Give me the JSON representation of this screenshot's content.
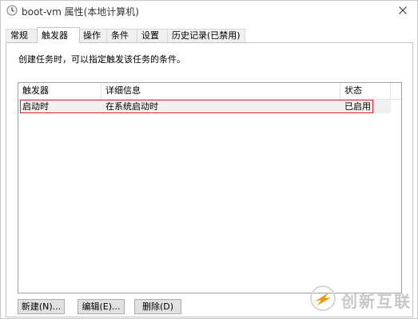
{
  "window": {
    "title": "boot-vm 属性(本地计算机)"
  },
  "tabs": [
    {
      "label": "常规",
      "active": false
    },
    {
      "label": "触发器",
      "active": true
    },
    {
      "label": "操作",
      "active": false
    },
    {
      "label": "条件",
      "active": false
    },
    {
      "label": "设置",
      "active": false
    },
    {
      "label": "历史记录(已禁用)",
      "active": false
    }
  ],
  "panel": {
    "description": "创建任务时，可以指定触发该任务的条件。"
  },
  "table": {
    "columns": [
      "触发器",
      "详细信息",
      "状态"
    ],
    "rows": [
      {
        "trigger": "启动时",
        "details": "在系统启动时",
        "status": "已启用"
      }
    ]
  },
  "buttons": {
    "new": "新建(N)...",
    "edit": "编辑(E)...",
    "delete": "删除(D)"
  },
  "watermark": {
    "text": "创新互联"
  },
  "colors": {
    "highlight_border": "#e0262a",
    "selected_row": "#f0f0f0",
    "watermark_accent": "#f29400"
  }
}
